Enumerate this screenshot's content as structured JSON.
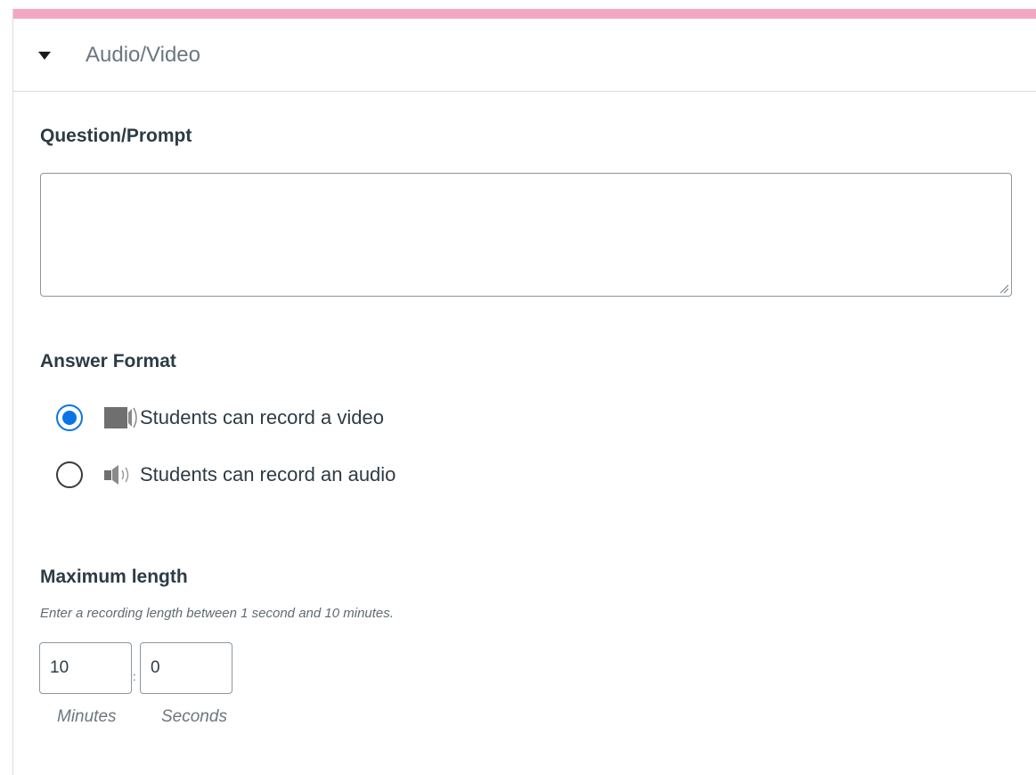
{
  "section": {
    "title": "Audio/Video",
    "accent_color": "#f4a7c0"
  },
  "prompt": {
    "label": "Question/Prompt",
    "value": ""
  },
  "answer_format": {
    "label": "Answer Format",
    "options": [
      {
        "label": "Students can record a video",
        "icon": "video-camera-icon",
        "selected": true
      },
      {
        "label": "Students can record an audio",
        "icon": "speaker-icon",
        "selected": false
      }
    ],
    "selected_color": "#0b74e5"
  },
  "max_length": {
    "label": "Maximum length",
    "hint": "Enter a recording length between 1 second and 10 minutes.",
    "minutes_value": "10",
    "seconds_value": "0",
    "separator": ":",
    "minutes_label": "Minutes",
    "seconds_label": "Seconds"
  }
}
